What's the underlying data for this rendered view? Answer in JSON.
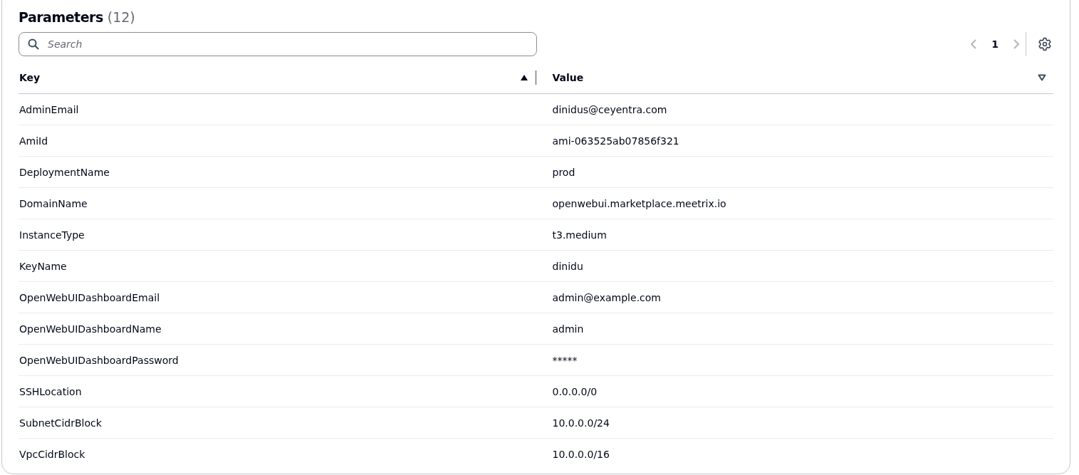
{
  "panel": {
    "title": "Parameters",
    "count": "(12)"
  },
  "search": {
    "placeholder": "Search"
  },
  "pagination": {
    "prev_disabled": true,
    "page": "1",
    "next_disabled": true
  },
  "table": {
    "columns": [
      {
        "label": "Key",
        "sorted": true
      },
      {
        "label": "Value",
        "sorted": false
      }
    ],
    "rows": [
      {
        "key": "AdminEmail",
        "value": "dinidus@ceyentra.com"
      },
      {
        "key": "AmiId",
        "value": "ami-063525ab07856f321"
      },
      {
        "key": "DeploymentName",
        "value": "prod"
      },
      {
        "key": "DomainName",
        "value": "openwebui.marketplace.meetrix.io"
      },
      {
        "key": "InstanceType",
        "value": "t3.medium"
      },
      {
        "key": "KeyName",
        "value": "dinidu"
      },
      {
        "key": "OpenWebUIDashboardEmail",
        "value": "admin@example.com"
      },
      {
        "key": "OpenWebUIDashboardName",
        "value": "admin"
      },
      {
        "key": "OpenWebUIDashboardPassword",
        "value": "*****"
      },
      {
        "key": "SSHLocation",
        "value": "0.0.0.0/0"
      },
      {
        "key": "SubnetCidrBlock",
        "value": "10.0.0.0/24"
      },
      {
        "key": "VpcCidrBlock",
        "value": "10.0.0.0/16"
      }
    ]
  }
}
